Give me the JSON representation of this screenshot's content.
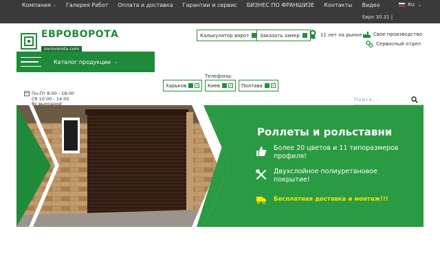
{
  "topnav": {
    "items": [
      {
        "label": "Компания",
        "has_dropdown": true
      },
      {
        "label": "Галерея Работ",
        "has_dropdown": false
      },
      {
        "label": "Оплата и доставка",
        "has_dropdown": false
      },
      {
        "label": "Гарантии и сервис",
        "has_dropdown": false
      },
      {
        "label": "БИЗНЕС ПО ФРАНШИЗЕ",
        "has_dropdown": false
      },
      {
        "label": "Контакты",
        "has_dropdown": false
      },
      {
        "label": "Видео",
        "has_dropdown": false
      }
    ],
    "language": "RU",
    "currency_rate": "Евро  30.31  |"
  },
  "logo": {
    "name": "ЕВРОВОРОТА",
    "domain": "evrovorota.com"
  },
  "header": {
    "calc_button": "Калькулятор ворот",
    "zamer_button": "Заказать замер",
    "years_text": "11 лет на рынке",
    "feature_production": "Свое производство",
    "feature_service": "Сервисный отдел"
  },
  "catalog": {
    "label": "Каталог продукции"
  },
  "phones": {
    "label": "Телефоны:",
    "cities": [
      "Харьков",
      "Киев",
      "Полтава"
    ]
  },
  "hours": {
    "line1": "Пн-Пт 8:00 - 18:00",
    "line2": "Сб 10:00 - 14:00",
    "line3": "Вс выходной"
  },
  "search": {
    "placeholder": "Поиск..."
  },
  "banner": {
    "title": "Роллеты и рольставни",
    "item1": "Более 20 цветов и 11 типоразмеров профиля!",
    "item2": "Двухслойное полиуретановое покрытие!",
    "item3": "Бесплатная доставка и монтаж!!!"
  },
  "colors": {
    "brand_green": "#1f8a3a",
    "topbar": "#3a3a3a",
    "highlight_yellow": "#f5e500"
  },
  "icons": [
    "chevron-down-icon",
    "ru-flag-icon",
    "logo-mark-icon",
    "calculator-icon",
    "measure-icon",
    "medal-icon",
    "factory-icon",
    "gears-icon",
    "hamburger-icon",
    "phone-icon",
    "clock-icon",
    "search-icon",
    "thumbs-up-icon",
    "tools-icon",
    "truck-icon"
  ]
}
